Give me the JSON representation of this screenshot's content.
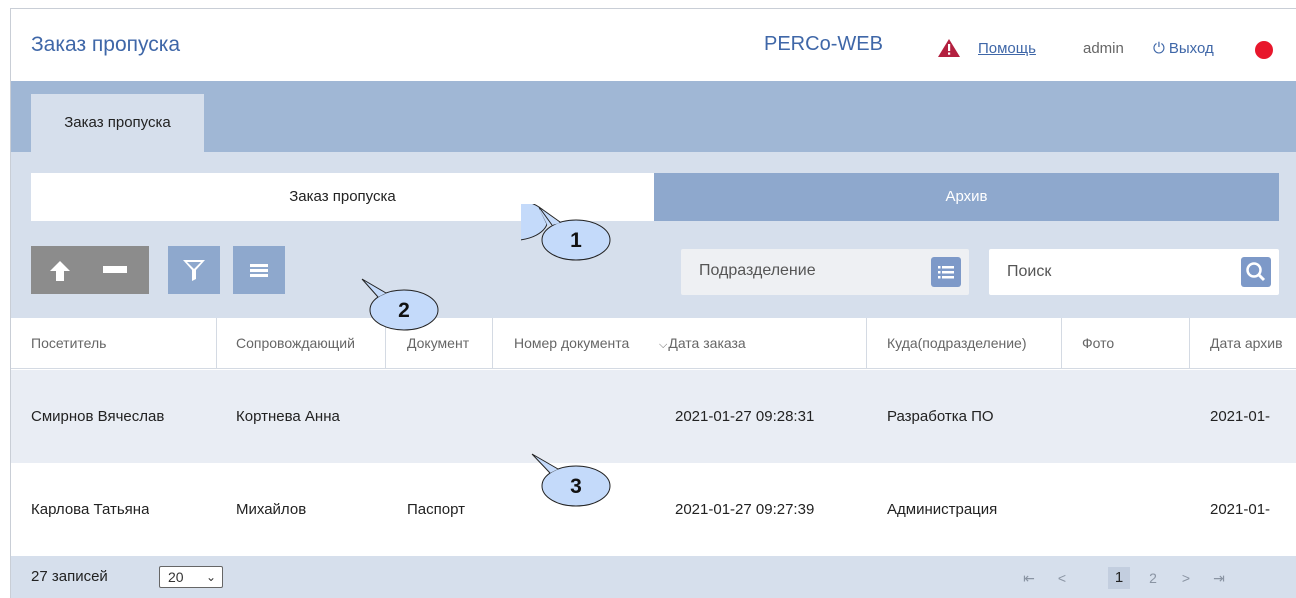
{
  "header": {
    "title": "Заказ пропуска",
    "brand": "PERCo-WEB",
    "help": "Помощь",
    "user": "admin",
    "logout": "Выход",
    "status_color": "#e8172c"
  },
  "tabs": [
    {
      "label": "Заказ пропуска",
      "active": true
    }
  ],
  "segments": {
    "active": "Заказ пропуска",
    "inactive": "Архив"
  },
  "toolbar": {
    "buttons": [
      "arrow-up-icon",
      "minus-icon",
      "filter-icon",
      "list-icon"
    ],
    "department_placeholder": "Подразделение",
    "search_placeholder": "Поиск"
  },
  "table": {
    "columns": [
      "Посетитель",
      "Сопровождающий",
      "Документ",
      "Номер документа",
      "Дата заказа",
      "Куда(подразделение)",
      "Фото",
      "Дата архив"
    ],
    "sorted_column": "Дата заказа",
    "rows": [
      [
        "Смирнов Вячеслав",
        "Кортнева Анна",
        "",
        "",
        "2021-01-27 09:28:31",
        "Разработка ПО",
        "",
        "2021-01-"
      ],
      [
        "Карлова Татьяна",
        "Михайлов",
        "Паспорт",
        "",
        "2021-01-27 09:27:39",
        "Администрация",
        "",
        "2021-01-"
      ]
    ]
  },
  "footer": {
    "count": "27 записей",
    "page_size": "20",
    "pages": [
      "1",
      "2"
    ],
    "current_page": "1"
  },
  "callouts": [
    "1",
    "2",
    "3"
  ],
  "colors": {
    "accent": "#3f67a8",
    "band": "#a0b7d5",
    "panel": "#d6dfec",
    "button": "#8ea8cd"
  }
}
